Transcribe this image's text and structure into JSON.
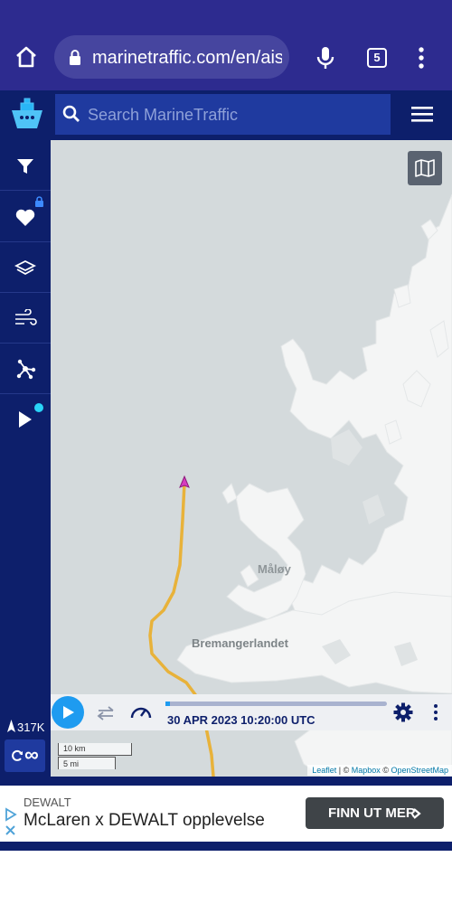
{
  "browser": {
    "url": "marinetraffic.com/en/ais",
    "tab_count": "5",
    "bar_color": "#2d2b8f"
  },
  "header": {
    "search_placeholder": "Search MarineTraffic",
    "icons": [
      "ship-logo-icon",
      "search-icon",
      "hamburger-menu-icon"
    ]
  },
  "sidebar": {
    "items": [
      {
        "icon": "filter-icon"
      },
      {
        "icon": "heart-icon",
        "locked": true
      },
      {
        "icon": "layers-icon"
      },
      {
        "icon": "wind-icon"
      },
      {
        "icon": "network-icon"
      },
      {
        "icon": "play-icon",
        "notification_dot": true
      }
    ],
    "vessel_count": "317K",
    "sync_label": "∞"
  },
  "map": {
    "labels": [
      "Måløy",
      "Bremangerlandet"
    ],
    "scale_metric": "10 km",
    "scale_imperial": "5 mi",
    "attribution": {
      "leaflet": "Leaflet",
      "sep1": " | © ",
      "mapbox": "Mapbox",
      "sep2": " © ",
      "osm": "OpenStreetMap"
    }
  },
  "playback": {
    "timestamp": "30 APR 2023 10:20:00 UTC",
    "progress": 0.02
  },
  "ad": {
    "brand": "DEWALT",
    "title": "McLaren x DEWALT opplevelse",
    "cta": "FINN UT MER"
  },
  "colors": {
    "navy": "#0d1f6b",
    "accent": "#1e9bf0",
    "track": "#e8b23a",
    "water": "#d4dadc",
    "land": "#f4f5f5"
  }
}
